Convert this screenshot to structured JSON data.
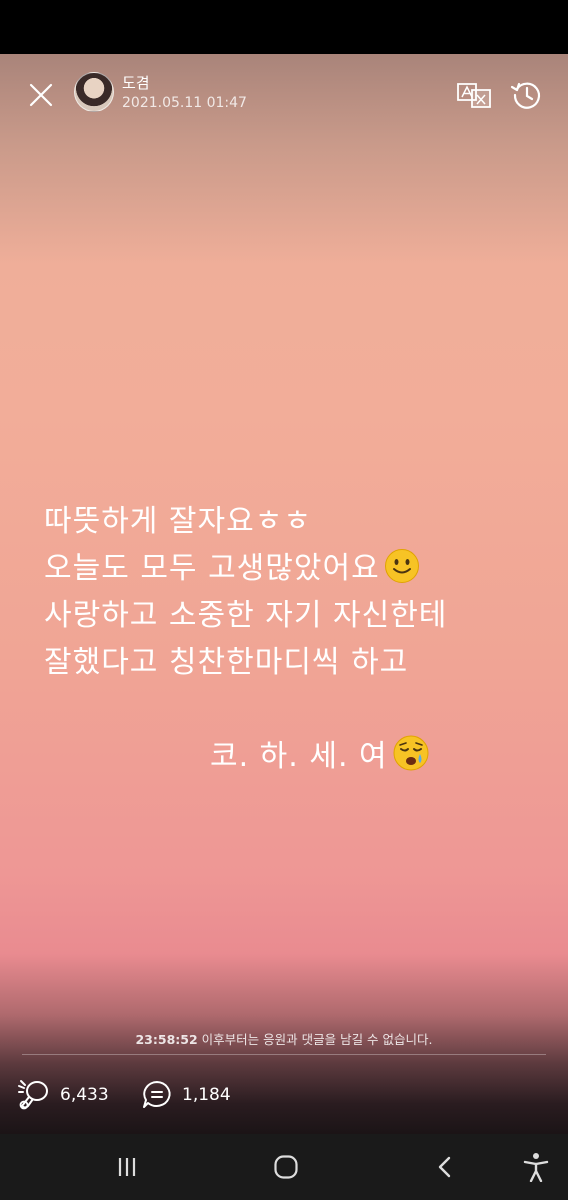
{
  "header": {
    "user_name": "도겸",
    "timestamp": "2021.05.11 01:47",
    "icons": [
      "close-icon",
      "translate-icon",
      "history-icon"
    ]
  },
  "message": {
    "lines": [
      "따뜻하게 잘자요ㅎㅎ",
      "오늘도 모두 고생많았어요",
      "사랑하고 소중한 자기 자신한테",
      "잘했다고 칭찬한마디씩 하고",
      "코. 하. 세. 여"
    ],
    "emojis": [
      "slightly-smiling-face-emoji",
      "sleepy-face-emoji"
    ]
  },
  "notice": {
    "time": "23:58:52",
    "text": " 이후부터는 응원과 댓글을 남길 수 없습니다."
  },
  "stats": {
    "cheers": "6,433",
    "comments": "1,184"
  },
  "nav_bar": {
    "icons": [
      "recent-apps-icon",
      "home-icon",
      "back-icon",
      "accessibility-icon"
    ]
  },
  "colors": {
    "story_top": "#a9847a",
    "story_middle": "#f2ad99",
    "story_bottom": "#e98b90",
    "nav_background": "#1a1a1a"
  }
}
